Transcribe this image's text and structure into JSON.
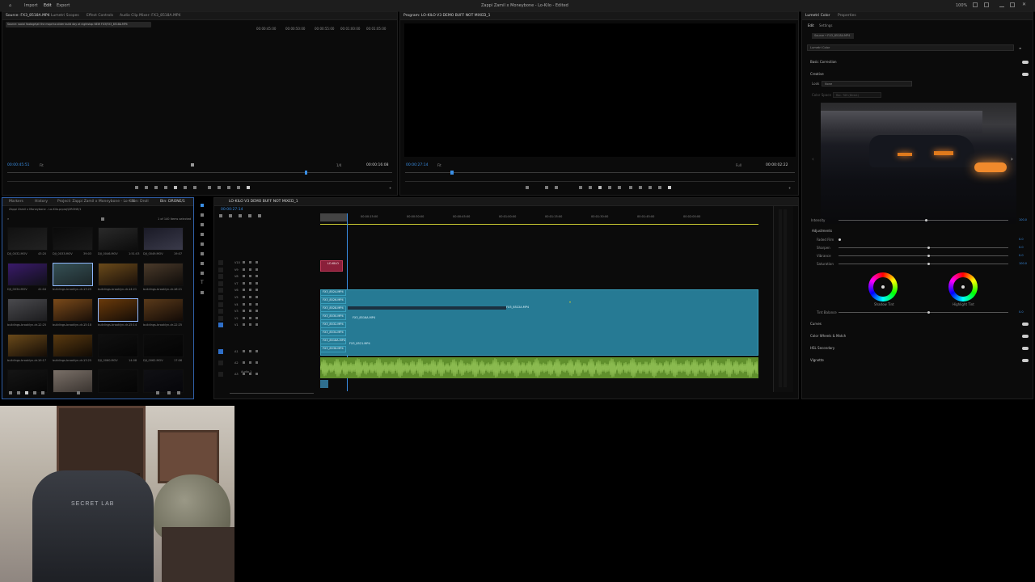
{
  "menu": {
    "home_icon": "home-icon",
    "items": [
      "Import",
      "Edit",
      "Export"
    ],
    "project_title": "Zappi Zamil x Moneybone - Lo-Kilo - Edited",
    "right_label": "100%"
  },
  "source_panel": {
    "tabs": [
      "Source: FX3_8518A.MP4",
      "Lumetri Scopes",
      "Effect Controls",
      "Audio Clip Mixer: FX3_8518A.MP4"
    ],
    "clip_path": "Source: social footage\\all the moprino slider build day at nightstop NEW FX3\\FX3_8518A.MP4",
    "timecode_in": "00:00:45:51",
    "timecode_out": "00:00:16:08",
    "fit": "Fit",
    "quality": "1/4",
    "ruler_labels": [
      "00:00:45:00",
      "00:00:50:00",
      "00:00:55:00",
      "00:01:00:00",
      "00:01:05:00"
    ]
  },
  "program_panel": {
    "title": "Program: LO-KILO V3 DEMO BUFF NOT MIXED_1",
    "timecode_in": "00:00:27:14",
    "timecode_out": "00:00:02:22",
    "fit": "Fit",
    "quality": "Full"
  },
  "lumetri_panel": {
    "tabs": [
      "Lumetri Color",
      "Properties"
    ],
    "subtabs": [
      "Edit",
      "Settings"
    ],
    "source_clip": "Source • FX3_8518A.MP4",
    "effect": "Lumetri Color",
    "sections": [
      "Basic Correction",
      "Creative"
    ],
    "look_label": "Look",
    "look_value": "None",
    "color_space_label": "Color Space",
    "color_space_value": "Rec. 709 (Direct)",
    "intensity_label": "Intensity",
    "intensity_value": "100.0",
    "adjustments_label": "Adjustments",
    "adjustment_rows": [
      {
        "label": "Faded Film",
        "value": "0.0"
      },
      {
        "label": "Sharpen",
        "value": "0.0"
      },
      {
        "label": "Vibrance",
        "value": "0.0"
      },
      {
        "label": "Saturation",
        "value": "100.0"
      }
    ],
    "wheels": [
      "Shadow Tint",
      "Highlight Tint"
    ],
    "tint_balance_label": "Tint Balance",
    "tint_balance_value": "0.0",
    "more_sections": [
      "Curves",
      "Color Wheels & Match",
      "HSL Secondary",
      "Vignette"
    ]
  },
  "project_panel": {
    "tabs": [
      "Markers",
      "History",
      "Project: Zappi Zamil x Moneybone - Lo-Kilo",
      "Bin: Droll",
      "Bin: DRONE/1"
    ],
    "path": "Zappi Zamil x Moneybone - Lo-Kilo.prproj\\DRONE/1",
    "count": "1 of 140 items selected",
    "thumbnails": [
      {
        "label": "DJI_0032.MOV",
        "dur": "43:20"
      },
      {
        "label": "DJI_0033.MOV",
        "dur": "39:03"
      },
      {
        "label": "DJI_0046.MOV",
        "dur": "1:51:03"
      },
      {
        "label": "DJI_0049.MOV",
        "dur": "19:07"
      },
      {
        "label": "DJI_0034.MOV",
        "dur": "41:04"
      },
      {
        "label": "buildings-brooklyn-dr...",
        "dur": "13:25"
      },
      {
        "label": "buildings-brooklyn-dr...",
        "dur": "14:21"
      },
      {
        "label": "buildings-brooklyn-dr...",
        "dur": "16:21"
      },
      {
        "label": "buildings-brooklyn-dr...",
        "dur": "12:25"
      },
      {
        "label": "buildings-brooklyn-dr...",
        "dur": "15:18"
      },
      {
        "label": "buildings-brooklyn-dr...",
        "dur": "15:14"
      },
      {
        "label": "buildings-brooklyn-dr...",
        "dur": "12:25"
      },
      {
        "label": "buildings-brooklyn-dr...",
        "dur": "19:17"
      },
      {
        "label": "buildings-brooklyn-dr...",
        "dur": "13:25"
      },
      {
        "label": "DJI_0060.MOV",
        "dur": "14:08"
      },
      {
        "label": "DJI_0062.MOV",
        "dur": "17:06"
      },
      {
        "label": "",
        "dur": ""
      },
      {
        "label": "",
        "dur": ""
      },
      {
        "label": "",
        "dur": ""
      },
      {
        "label": "",
        "dur": ""
      }
    ]
  },
  "timeline_panel": {
    "title": "LO-KILO V3 DEMO BUFF NOT MIXED_1",
    "timecode": "00:00:27:14",
    "ruler": [
      "00:00:15:00",
      "00:00:30:00",
      "00:00:45:00",
      "00:01:00:00",
      "00:01:15:00",
      "00:01:30:00",
      "00:01:45:00",
      "00:02:00:00"
    ],
    "track_names": [
      "V10",
      "V9",
      "V8",
      "V7",
      "V6",
      "V5",
      "V4",
      "V3",
      "V2",
      "V1",
      "A1",
      "A2",
      "A3"
    ],
    "clip_labels": [
      "FX3_8524.MP4",
      "FX3_8526.MP4",
      "FX3_8528.MP4",
      "FX3_8530.MP4",
      "FX3_8532.MP4",
      "FX3_8534.MP4",
      "FX3_8518A.MP4",
      "FX3_8536.MP4"
    ],
    "float_labels": [
      "FX3_8522A.MP4",
      "FX3_8516A.MP4",
      "FX3_8521.MP4"
    ],
    "graphic_label": "LO-KILO",
    "audio_label": "Audio 1"
  },
  "webcam": {
    "chair_text": "SECRET LAB"
  },
  "colors": {
    "accent": "#3a8fe6",
    "clip": "#267a94",
    "audio": "#6a9e32",
    "ruler_yellow": "#c8c832"
  }
}
